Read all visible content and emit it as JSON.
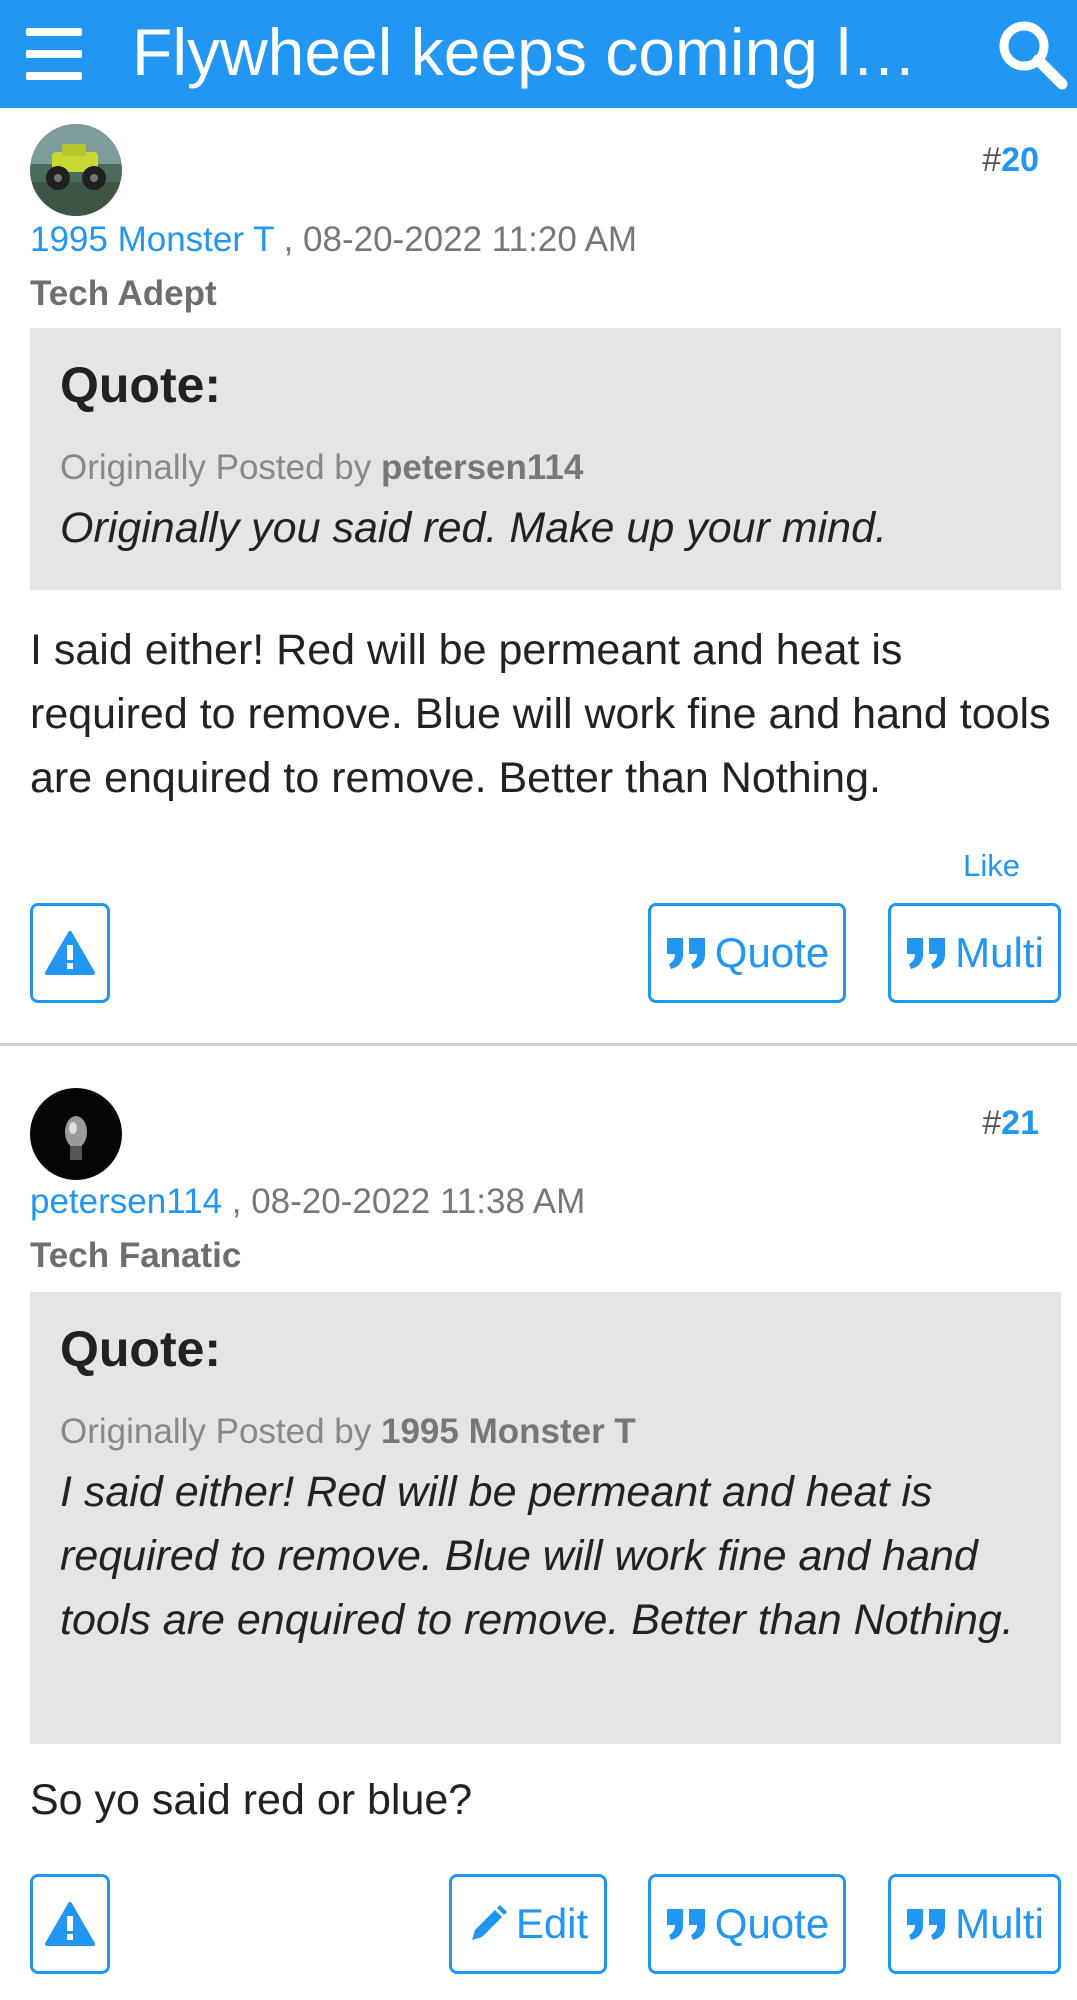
{
  "header": {
    "title": "Flywheel keeps coming l…",
    "menu_icon": "hamburger-menu-icon",
    "search_icon": "search-icon",
    "background_color": "#2196f3"
  },
  "posts": [
    {
      "number_prefix": "#",
      "number": "20",
      "author": "1995 Monster T",
      "timestamp": ", 08-20-2022 11:20 AM",
      "rank": "Tech Adept",
      "avatar_icon": "monster-truck-avatar",
      "quote": {
        "label": "Quote:",
        "originally_posted_by": "Originally Posted by",
        "original_author": "petersen114",
        "text": "Originally you said red. Make up your mind."
      },
      "body": "I said either! Red will be permeant and heat is required to remove. Blue will work fine and hand tools are enquired to remove. Better than Nothing.",
      "like_label": "Like",
      "buttons": {
        "report_icon": "warning-icon",
        "quote_label": "Quote",
        "multi_label": "Multi"
      }
    },
    {
      "number_prefix": "#",
      "number": "21",
      "author": "petersen114",
      "timestamp": ", 08-20-2022 11:38 AM",
      "rank": "Tech Fanatic",
      "avatar_icon": "dark-portrait-avatar",
      "quote": {
        "label": "Quote:",
        "originally_posted_by": "Originally Posted by",
        "original_author": "1995 Monster T",
        "text": "I said either! Red will be permeant and heat is required to remove. Blue will work fine and hand tools are enquired to remove. Better than Nothing."
      },
      "body": "So yo said red or blue?",
      "buttons": {
        "report_icon": "warning-icon",
        "edit_label": "Edit",
        "quote_label": "Quote",
        "multi_label": "Multi"
      }
    }
  ],
  "colors": {
    "accent": "#2196f3",
    "quote_background": "#e5e5e5",
    "muted_text": "#777777"
  }
}
